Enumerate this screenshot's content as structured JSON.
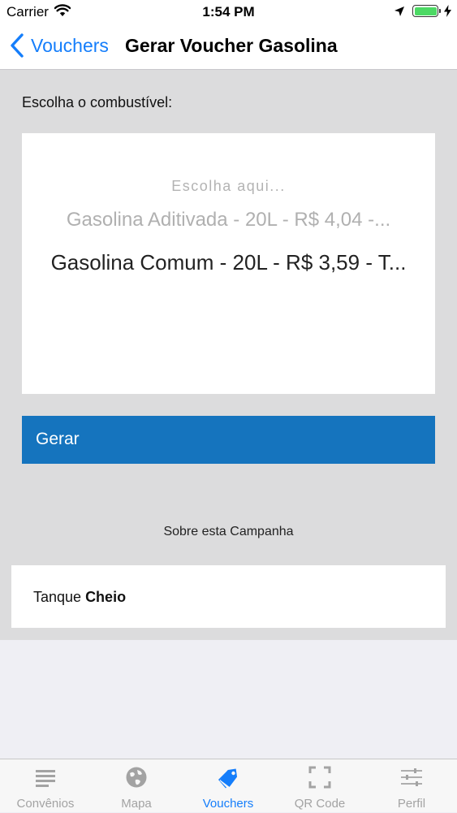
{
  "status_bar": {
    "carrier": "Carrier",
    "time": "1:54 PM",
    "battery_color": "#4cd964"
  },
  "nav": {
    "back_label": "Vouchers",
    "title": "Gerar Voucher Gasolina"
  },
  "form": {
    "choose_label": "Escolha o combustível:",
    "picker": {
      "placeholder": "Escolha aqui...",
      "options": [
        "Gasolina Aditivada - 20L - R$ 4,04 -...",
        "Gasolina Comum - 20L - R$ 3,59 - T..."
      ],
      "selected_index": 1
    },
    "generate_label": "Gerar"
  },
  "campaign": {
    "heading": "Sobre esta Campanha",
    "text_prefix": "Tanque ",
    "text_bold": "Cheio"
  },
  "tab_bar": {
    "items": [
      {
        "label": "Convênios",
        "icon": "list-icon"
      },
      {
        "label": "Mapa",
        "icon": "globe-icon"
      },
      {
        "label": "Vouchers",
        "icon": "tag-icon"
      },
      {
        "label": "QR Code",
        "icon": "qr-scan-icon"
      },
      {
        "label": "Perfil",
        "icon": "sliders-icon"
      }
    ],
    "active_index": 2,
    "active_color": "#157efb",
    "inactive_color": "#a3a3a3"
  },
  "colors": {
    "accent": "#157efb",
    "button": "#1574be",
    "content_bg": "#dcdcdd"
  }
}
